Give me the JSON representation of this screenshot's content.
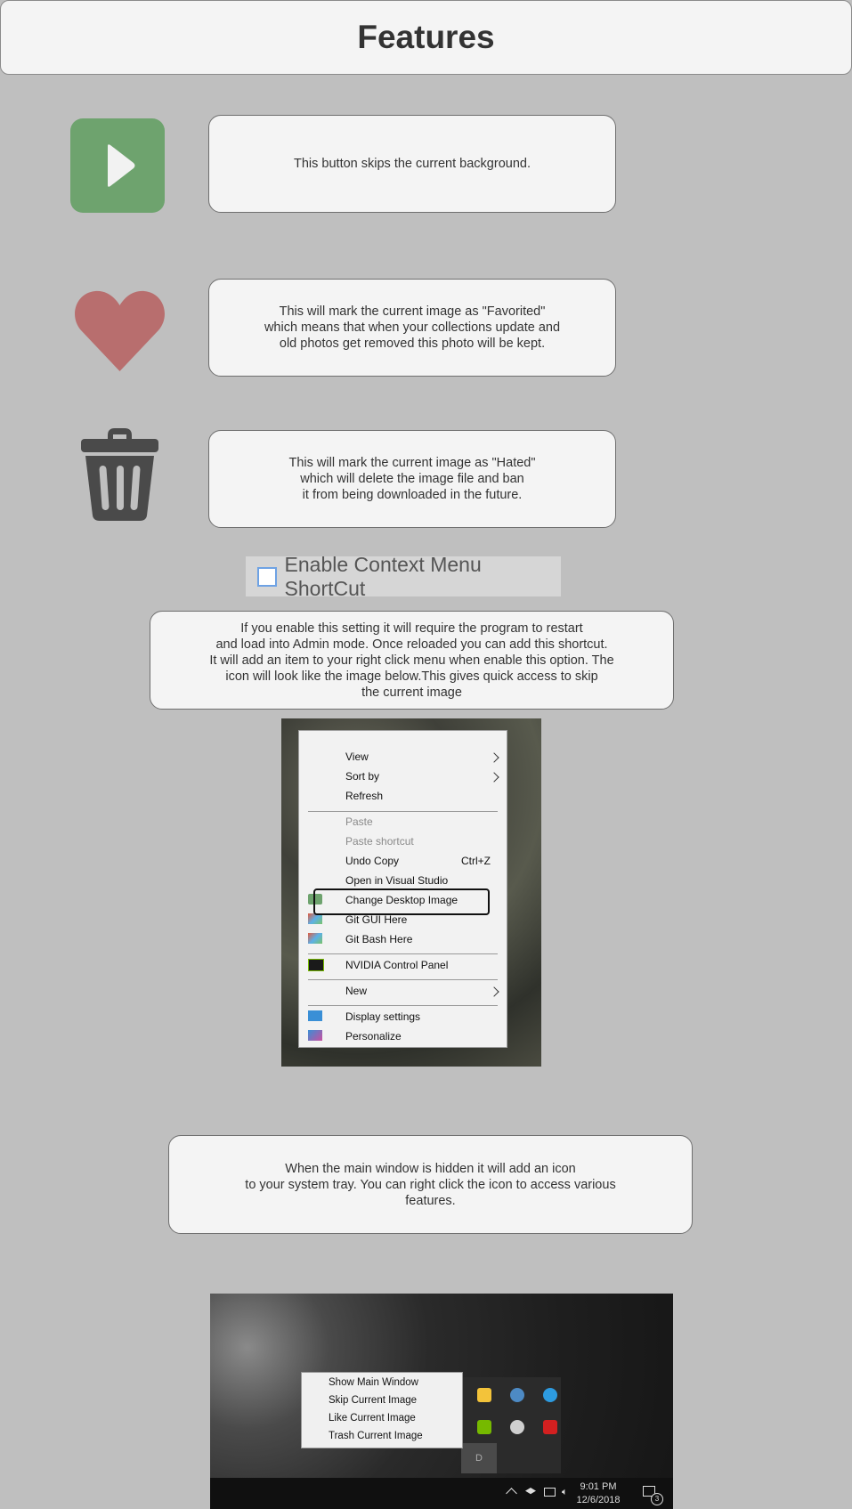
{
  "header": {
    "title": "Features"
  },
  "features": {
    "skip": {
      "icon": "play-icon",
      "color": "#6ea36e",
      "text": "This button skips the current background."
    },
    "favorite": {
      "icon": "heart-icon",
      "color": "#b86e6e",
      "text": "This will mark the current image as \"Favorited\"\nwhich means that when your collections update and\nold photos get removed this photo will be kept."
    },
    "hate": {
      "icon": "trash-icon",
      "color": "#4a4a4a",
      "text": "This will mark the current image as \"Hated\"\nwhich will delete the image file and ban\nit from being downloaded in the future."
    }
  },
  "context_menu_option": {
    "label": "Enable Context Menu ShortCut",
    "checked": false,
    "description": "If you enable this setting it will require the program to restart\nand load into Admin mode. Once reloaded you can add this shortcut.\nIt will add an item to your right click menu when enable this option. The\nicon will look like the image below.This gives quick access to skip\nthe current image"
  },
  "context_menu_screenshot": {
    "items": {
      "view": "View",
      "sort_by": "Sort by",
      "refresh": "Refresh",
      "paste": "Paste",
      "paste_shortcut": "Paste shortcut",
      "undo_copy": "Undo Copy",
      "undo_shortcut": "Ctrl+Z",
      "open_vs": "Open in Visual Studio",
      "change_desktop": "Change Desktop Image",
      "git_gui": "Git GUI Here",
      "git_bash": "Git Bash Here",
      "nvidia": "NVIDIA Control Panel",
      "new": "New",
      "display_settings": "Display settings",
      "personalize": "Personalize"
    }
  },
  "tray": {
    "description": "When the main window is hidden it will add an icon\nto your system tray. You can right click the icon to access various\nfeatures.",
    "menu": {
      "show_main": "Show Main Window",
      "skip": "Skip Current Image",
      "like": "Like Current Image",
      "trash": "Trash Current Image"
    },
    "flyout_letter": "D",
    "time": "9:01 PM",
    "date": "12/6/2018",
    "notification_count": "3"
  }
}
